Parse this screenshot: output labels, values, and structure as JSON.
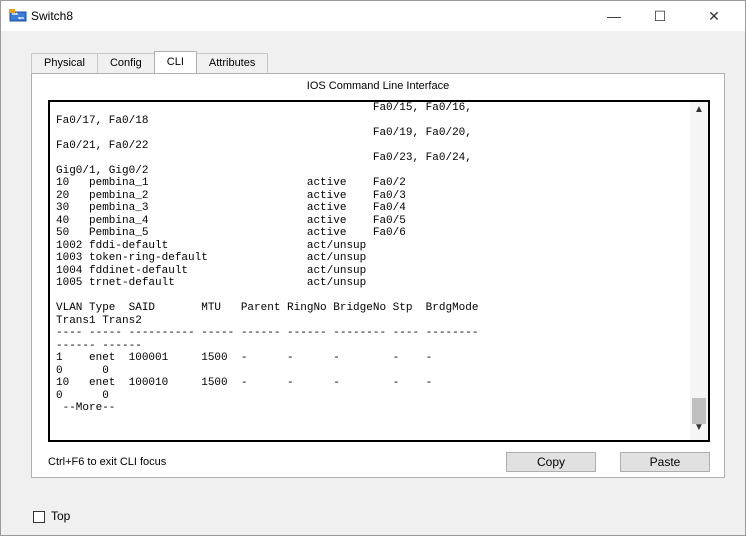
{
  "window": {
    "title": "Switch8",
    "minimize_glyph": "—",
    "maximize_glyph": "☐",
    "close_glyph": "✕"
  },
  "tabs": [
    {
      "label": "Physical"
    },
    {
      "label": "Config"
    },
    {
      "label": "CLI",
      "active": true
    },
    {
      "label": "Attributes"
    }
  ],
  "panel": {
    "title": "IOS Command Line Interface"
  },
  "cli": {
    "output": "                                                Fa0/15, Fa0/16,\nFa0/17, Fa0/18\n                                                Fa0/19, Fa0/20,\nFa0/21, Fa0/22\n                                                Fa0/23, Fa0/24,\nGig0/1, Gig0/2\n10   pembina_1                        active    Fa0/2\n20   pembina_2                        active    Fa0/3\n30   pembina_3                        active    Fa0/4\n40   pembina_4                        active    Fa0/5\n50   Pembina_5                        active    Fa0/6\n1002 fddi-default                     act/unsup\n1003 token-ring-default               act/unsup\n1004 fddinet-default                  act/unsup\n1005 trnet-default                    act/unsup\n\nVLAN Type  SAID       MTU   Parent RingNo BridgeNo Stp  BrdgMode\nTrans1 Trans2\n---- ----- ---------- ----- ------ ------ -------- ---- --------\n------ ------\n1    enet  100001     1500  -      -      -        -    -\n0      0\n10   enet  100010     1500  -      -      -        -    -\n0      0\n --More--",
    "scroll_up_icon": "▲",
    "scroll_down_icon": "▼"
  },
  "footer": {
    "hint": "Ctrl+F6 to exit CLI focus",
    "copy_label": "Copy",
    "paste_label": "Paste"
  },
  "top_option": {
    "label": "Top",
    "checked": false
  }
}
